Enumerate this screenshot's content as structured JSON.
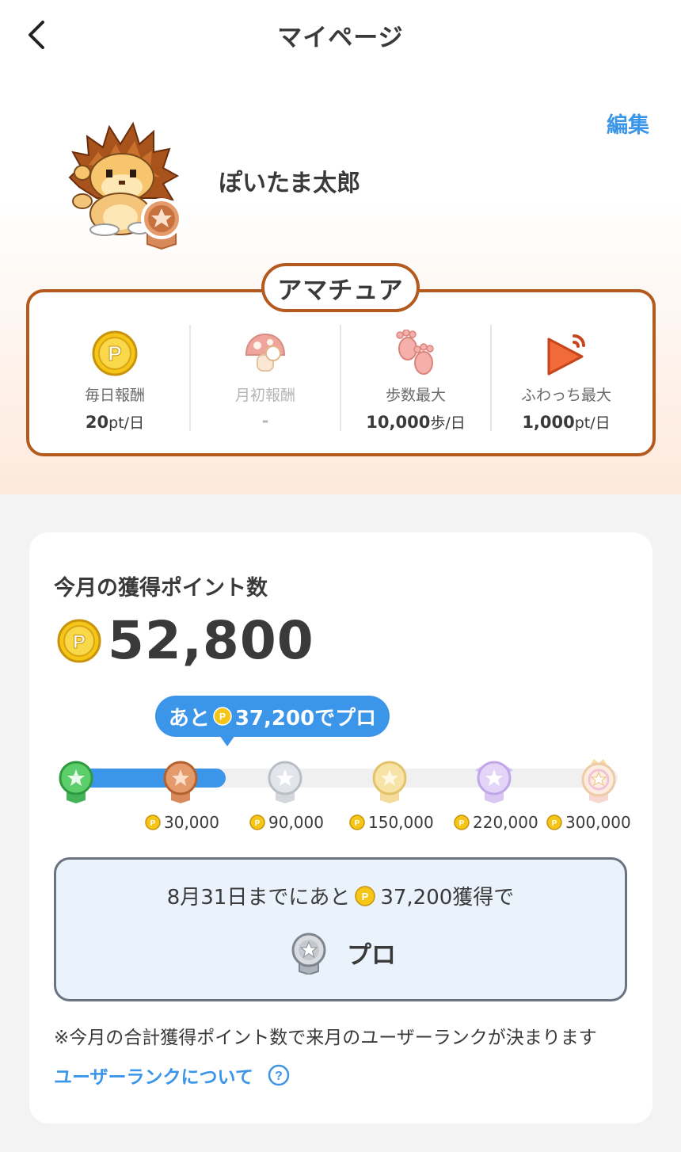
{
  "header": {
    "title": "マイページ"
  },
  "profile": {
    "edit_label": "編集",
    "user_name": "ぽいたま太郎"
  },
  "rank": {
    "current": "アマチュア",
    "perks": [
      {
        "label": "毎日報酬",
        "value": "20",
        "unit": "pt/日",
        "icon": "daily-coin-icon"
      },
      {
        "label": "月初報酬",
        "value": "-",
        "unit": "",
        "icon": "mushroom-icon"
      },
      {
        "label": "歩数最大",
        "value": "10,000",
        "unit": "歩/日",
        "icon": "footprints-icon"
      },
      {
        "label": "ふわっち最大",
        "value": "1,000",
        "unit": "pt/日",
        "icon": "play-icon"
      }
    ]
  },
  "points": {
    "title": "今月の獲得ポイント数",
    "value": "52,800",
    "bubble_prefix": "あと",
    "bubble_amount": "37,200でプロ",
    "progress_fraction": 0.176,
    "milestones": [
      "30,000",
      "90,000",
      "150,000",
      "220,000",
      "300,000"
    ]
  },
  "goal": {
    "prefix": "8月31日までにあと",
    "suffix": "37,200獲得で",
    "next_rank": "プロ"
  },
  "note": "※今月の合計獲得ポイント数で来月のユーザーランクが決まります",
  "rank_link": "ユーザーランクについて",
  "colors": {
    "accent": "#3b95e8",
    "rank_border": "#b35a1e",
    "page_bg": "#f4f3f3"
  }
}
